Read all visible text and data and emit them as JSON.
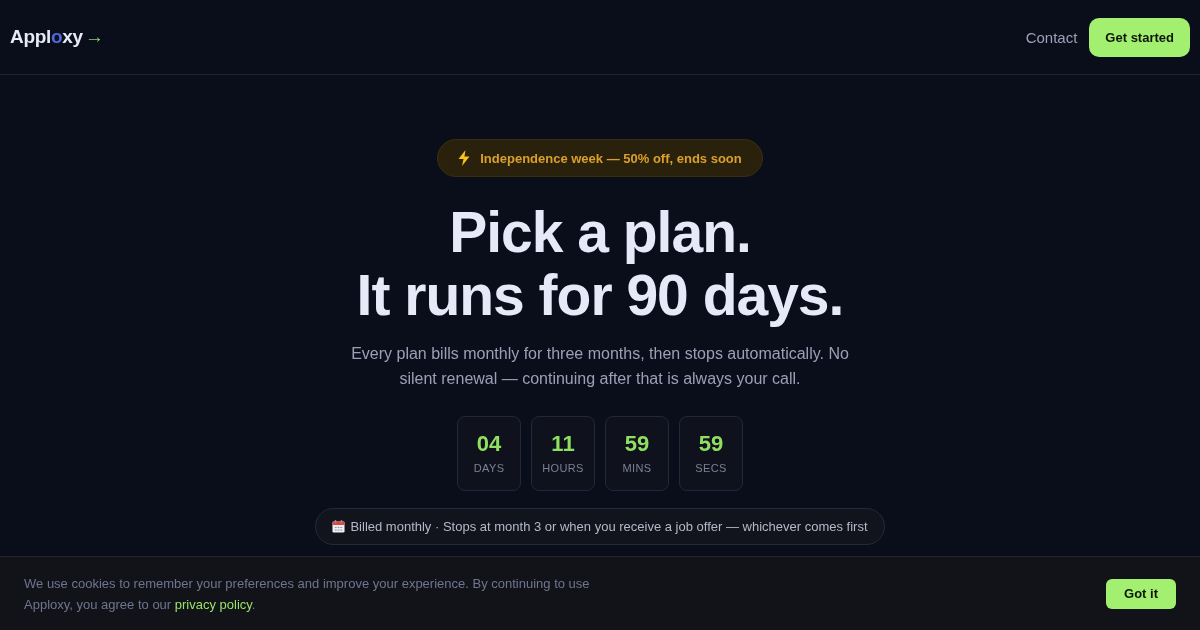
{
  "header": {
    "logo": [
      {
        "kind": "text",
        "text": "Appl"
      },
      {
        "kind": "accent",
        "text": "o"
      },
      {
        "kind": "text",
        "text": "xy"
      },
      {
        "kind": "arrow",
        "text": "→"
      }
    ],
    "nav_links": [
      "Contact"
    ],
    "cta": "Get started"
  },
  "promo_badge": {
    "text": "Independence week — 50% off, ends soon"
  },
  "headline": [
    "Pick a plan.",
    "It runs for 90 days."
  ],
  "subtitle": "Every plan bills monthly for three months, then stops automatically. No silent renewal — continuing after that is always your call.",
  "countdown": [
    {
      "value": "04",
      "unit": "DAYS"
    },
    {
      "value": "11",
      "unit": "HOURS"
    },
    {
      "value": "59",
      "unit": "MINS"
    },
    {
      "value": "59",
      "unit": "SECS"
    }
  ],
  "billing_note": "Billed monthly · Stops at month 3 or when you receive a job offer — whichever comes first",
  "cookie_bar": {
    "text": "We use cookies to remember your preferences and improve your experience. By continuing to use Apploxy, you agree to our ",
    "link": "privacy policy",
    "text_end": ".",
    "button": "Got it"
  }
}
